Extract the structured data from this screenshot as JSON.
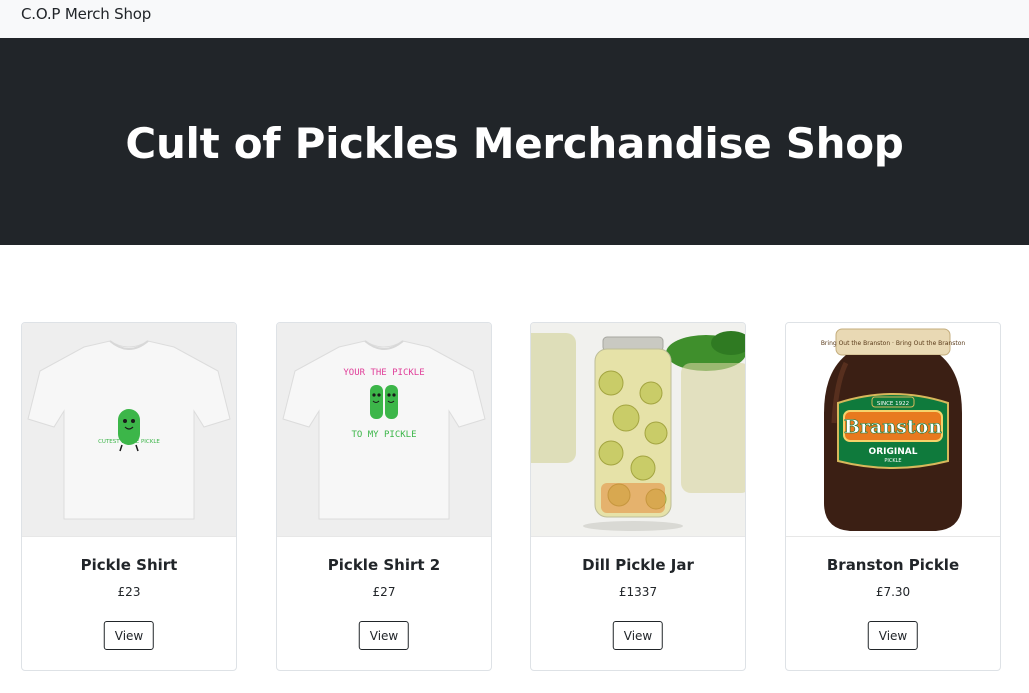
{
  "navbar": {
    "brand": "C.O.P Merch Shop"
  },
  "hero": {
    "title": "Cult of Pickles Merchandise Shop"
  },
  "products": [
    {
      "name": "Pickle Shirt",
      "price": "£23",
      "button": "View",
      "image": "white-tshirt-pickle-icon"
    },
    {
      "name": "Pickle Shirt 2",
      "price": "£27",
      "button": "View",
      "image": "white-tshirt-two-pickles-icon"
    },
    {
      "name": "Dill Pickle Jar",
      "price": "£1337",
      "button": "View",
      "image": "pickle-jar-photo"
    },
    {
      "name": "Branston Pickle",
      "price": "£7.30",
      "button": "View",
      "image": "branston-jar-photo"
    }
  ],
  "shirt1": {
    "caption": "CUTEST LITTLE PICKLE"
  },
  "shirt2": {
    "line1": "YOUR THE PICKLE",
    "line2": "TO MY PICKLE"
  },
  "branston": {
    "band": "Bring Out the Branston · Bring Out the Branston",
    "since": "SINCE 1922",
    "brand": "Branston",
    "variant": "ORIGINAL",
    "sub": "PICKLE"
  },
  "colors": {
    "hero_bg": "#212529",
    "navbar_bg": "#f8f9fa",
    "pickle_green": "#3cb649",
    "branston_green": "#0f7a3c",
    "branston_orange": "#e8791f"
  }
}
